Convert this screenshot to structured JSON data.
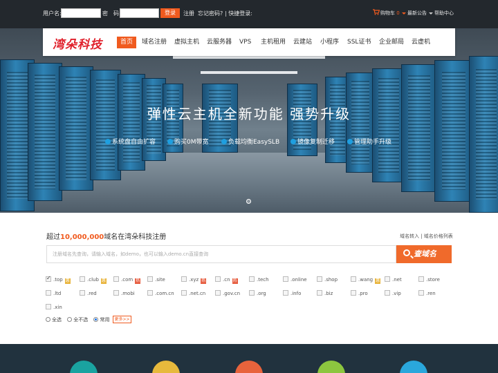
{
  "topbar": {
    "username_label": "用户名:",
    "password_label": "密　码:",
    "login_button": "登录",
    "register_link": "注册",
    "forgot_link": "忘记密码?",
    "quick_login": "| 快捷登录:",
    "cart_label": "购物车",
    "cart_count": "0",
    "news_label": "最新公告",
    "help_label": "帮助中心"
  },
  "nav": {
    "logo": "湾朵科技",
    "items": [
      {
        "label": "首页",
        "active": true
      },
      {
        "label": "域名注册"
      },
      {
        "label": "虚拟主机"
      },
      {
        "label": "云服务器"
      },
      {
        "label": "VPS"
      },
      {
        "label": "主机租用"
      },
      {
        "label": "云建站"
      },
      {
        "label": "小程序"
      },
      {
        "label": "SSL证书"
      },
      {
        "label": "企业邮局"
      },
      {
        "label": "云虚机"
      }
    ]
  },
  "hero": {
    "title": "弹性云主机全新功能  强势升级",
    "features": [
      "系统盘自由扩容",
      "购买0M带宽",
      "负载均衡EasySLB",
      "镜像复制迁移",
      "管理助手升级"
    ]
  },
  "domain": {
    "title_prefix": "超过",
    "title_count": "10,000,000",
    "title_suffix": "域名在湾朵科技注册",
    "links": "域名转入 | 域名价格列表",
    "search_placeholder": "注册域名先查询，请输入域名，如demo，也可以输入demo.cn直接查询",
    "search_button": "查域名",
    "tlds": [
      {
        "name": ".top",
        "checked": true,
        "badge": "hot"
      },
      {
        "name": ".club",
        "badge": "hot"
      },
      {
        "name": ".com",
        "badge": "new"
      },
      {
        "name": ".site"
      },
      {
        "name": ".xyz",
        "badge": "new"
      },
      {
        "name": ".cn",
        "badge": "new"
      },
      {
        "name": ".tech"
      },
      {
        "name": ".online"
      },
      {
        "name": ".shop"
      },
      {
        "name": ".wang",
        "badge": "hot"
      },
      {
        "name": ".net"
      },
      {
        "name": ".store"
      },
      {
        "name": ".ltd"
      },
      {
        "name": ".red"
      },
      {
        "name": ".mobi"
      },
      {
        "name": ".com.cn"
      },
      {
        "name": ".net.cn"
      },
      {
        "name": ".gov.cn"
      },
      {
        "name": ".org"
      },
      {
        "name": ".info"
      },
      {
        "name": ".biz"
      },
      {
        "name": ".pro"
      },
      {
        "name": ".vip"
      },
      {
        "name": ".ren"
      },
      {
        "name": ".xin"
      }
    ],
    "radio_options": [
      {
        "label": "全选"
      },
      {
        "label": "全不选"
      },
      {
        "label": "常用",
        "selected": true
      }
    ],
    "more_button": "更多>>"
  },
  "colors": {
    "accent": "#f05a1e",
    "topbar_bg": "#23282d",
    "bottom_bg": "#21323e",
    "feature_dot": "#1e9fe0",
    "badge_hot": "#e8b339",
    "badge_new": "#e65a3c"
  }
}
